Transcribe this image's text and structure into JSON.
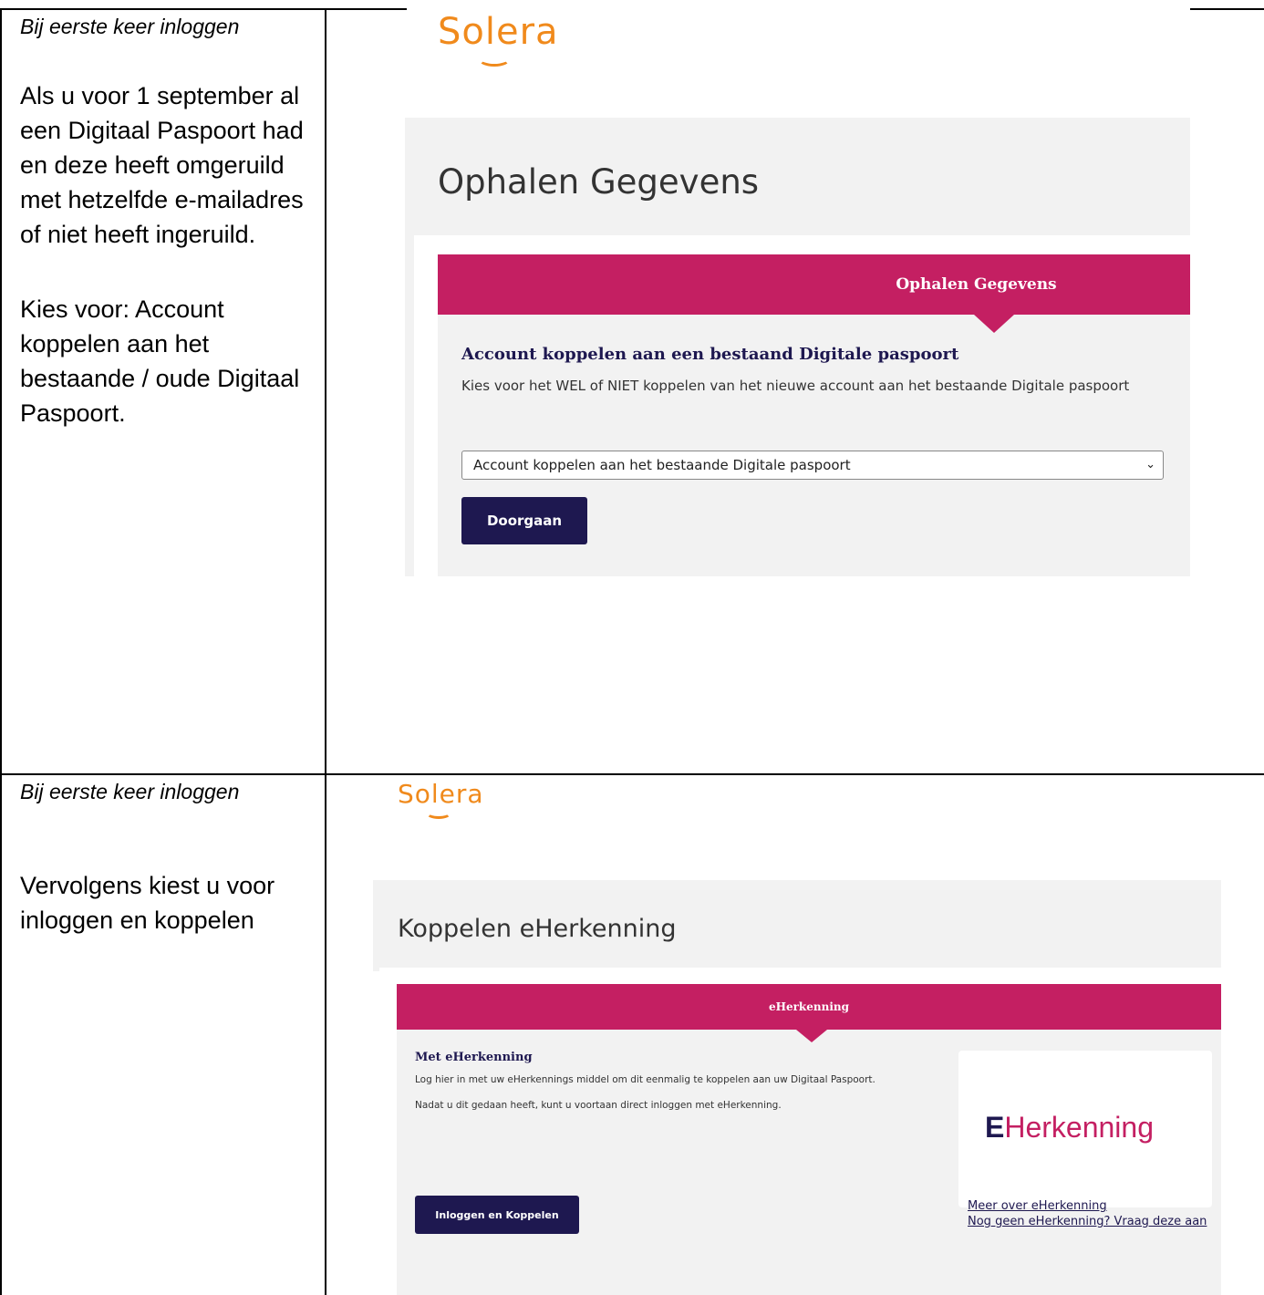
{
  "row1": {
    "left": {
      "heading": "Bij eerste keer inloggen",
      "paragraph1": "Als u voor 1 september al\neen Digitaal Paspoort had\nen deze heeft omgeruild\nmet hetzelfde e-mailadres\nof niet heeft ingeruild.",
      "paragraph2": "Kies voor: Account\nkoppelen aan het\nbestaande / oude Digitaal\nPaspoort."
    },
    "screenshot": {
      "logo": "Solera",
      "page_title": "Ophalen Gegevens",
      "banner": "Ophalen Gegevens",
      "section_title": "Account koppelen aan een bestaand Digitale paspoort",
      "description": "Kies voor het WEL of NIET koppelen van het nieuwe account aan het bestaande Digitale paspoort",
      "select_value": "Account koppelen aan het bestaande Digitale paspoort",
      "button": "Doorgaan"
    }
  },
  "row2": {
    "left": {
      "heading": "Bij eerste keer inloggen",
      "paragraph1": "Vervolgens kiest u voor\ninloggen en koppelen"
    },
    "screenshot": {
      "logo": "Solera",
      "page_title": "Koppelen eHerkenning",
      "banner": "eHerkenning",
      "section_title": "Met eHerkenning",
      "description_line1": "Log hier in met uw eHerkennings middel om dit eenmalig te koppelen aan uw Digitaal Paspoort.",
      "description_line2": "Nadat u dit gedaan heeft, kunt u voortaan direct inloggen met eHerkenning.",
      "brand_logo_text": "Herkenning",
      "button": "Inloggen en Koppelen",
      "link_more": "Meer over eHerkenning",
      "link_request": "Nog geen eHerkenning? Vraag deze aan"
    }
  },
  "colors": {
    "accent_pink": "#c41f62",
    "navy": "#1e1850",
    "logo_orange": "#f08a1c"
  }
}
